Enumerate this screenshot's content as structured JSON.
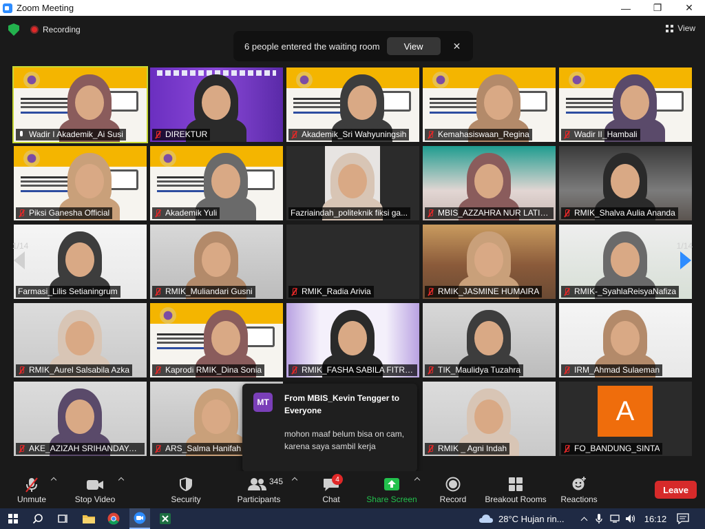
{
  "window": {
    "title": "Zoom Meeting",
    "min": "—",
    "max": "❐",
    "close": "✕"
  },
  "status": {
    "recording_label": "Recording",
    "view_label": "View"
  },
  "waiting_notice": {
    "message": "6 people entered the waiting room",
    "button": "View",
    "close": "✕"
  },
  "pager": {
    "left": "1/14",
    "right": "1/14"
  },
  "participants": [
    {
      "name": "Wadir I Akademik_Ai Susi",
      "muted": false,
      "active": true,
      "bg": "slide"
    },
    {
      "name": "DIREKTUR",
      "muted": true,
      "bg": "banner"
    },
    {
      "name": "Akademik_Sri Wahyuningsih",
      "muted": true,
      "bg": "slide"
    },
    {
      "name": "Kemahasiswaan_Regina",
      "muted": true,
      "bg": "slide"
    },
    {
      "name": "Wadir II_Hambali",
      "muted": true,
      "bg": "slide"
    },
    {
      "name": "Piksi Ganesha Official",
      "muted": true,
      "bg": "slide"
    },
    {
      "name": "Akademik Yuli",
      "muted": true,
      "bg": "slide"
    },
    {
      "name": "Fazriaindah_politeknik fiksi ga...",
      "muted": false,
      "no_icon": true,
      "bg": "dark"
    },
    {
      "name": "MBIS_AZZAHRA NUR LATIF...",
      "muted": true,
      "bg": "teal"
    },
    {
      "name": "RMIK_Shalva Aulia Ananda",
      "muted": true,
      "bg": "room"
    },
    {
      "name": "Farmasi_Lilis Setianingrum",
      "muted": false,
      "no_icon": true,
      "bg": "white"
    },
    {
      "name": "RMIK_Muliandari Gusni",
      "muted": true,
      "bg": "grey"
    },
    {
      "name": "RMIK_Radia Arivia",
      "muted": true,
      "bg": "dark"
    },
    {
      "name": "RMIK_JASMINE HUMAIRA",
      "muted": true,
      "bg": "warm"
    },
    {
      "name": "RMIK-_SyahlaReisyaNafiza",
      "muted": true,
      "bg": "light"
    },
    {
      "name": "RMIK_Aurel Salsabila Azka",
      "muted": true,
      "bg": "pale"
    },
    {
      "name": "Kaprodi RMIK_Dina Sonia",
      "muted": true,
      "bg": "slide"
    },
    {
      "name": "RMIK_FASHA SABILA FITRIA...",
      "muted": true,
      "bg": "purple"
    },
    {
      "name": "TIK_Maulidya Tuzahra",
      "muted": true,
      "bg": "grey"
    },
    {
      "name": "IRM_Ahmad Sulaeman",
      "muted": true,
      "bg": "white"
    },
    {
      "name": "AKE_AZIZAH SRIHANDAYANI",
      "muted": true,
      "bg": "pale"
    },
    {
      "name": "ARS_Salma Hanifah",
      "muted": true,
      "bg": "grey"
    },
    {
      "name": "",
      "muted": true,
      "bg": "hidden"
    },
    {
      "name": "RMIK _ Agni Indah",
      "muted": true,
      "bg": "pale"
    },
    {
      "name": "FO_BANDUNG_SINTA",
      "muted": true,
      "bg": "avatar",
      "avatar_letter": "A"
    }
  ],
  "chat_popup": {
    "initials": "MT",
    "from": "From MBIS_Kevin Tengger to Everyone",
    "message": "mohon maaf belum bisa on cam, karena saya sambil kerja"
  },
  "toolbar": {
    "unmute": "Unmute",
    "stop_video": "Stop Video",
    "security": "Security",
    "participants": "Participants",
    "participants_count": "345",
    "chat": "Chat",
    "chat_badge": "4",
    "share_screen": "Share Screen",
    "record": "Record",
    "breakout": "Breakout Rooms",
    "reactions": "Reactions",
    "leave": "Leave"
  },
  "taskbar": {
    "weather": "28°C  Hujan rin...",
    "time": "16:12",
    "accent": "#1f2a44"
  }
}
